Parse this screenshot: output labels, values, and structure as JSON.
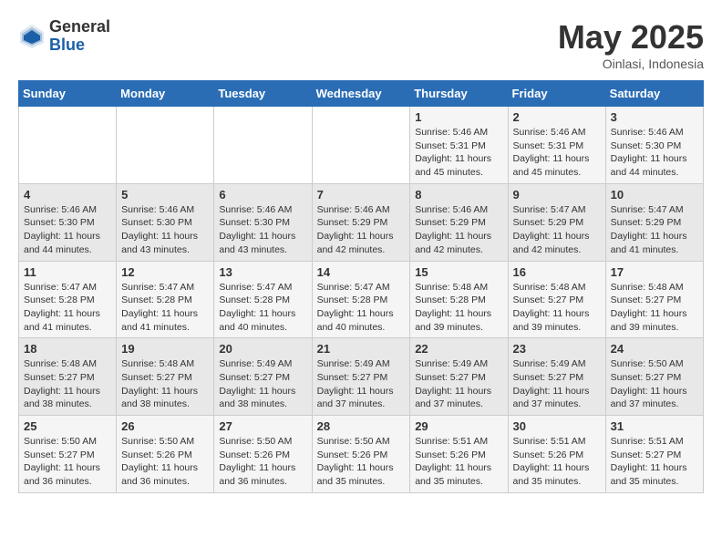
{
  "logo": {
    "general": "General",
    "blue": "Blue"
  },
  "title": "May 2025",
  "subtitle": "Oinlasi, Indonesia",
  "days_header": [
    "Sunday",
    "Monday",
    "Tuesday",
    "Wednesday",
    "Thursday",
    "Friday",
    "Saturday"
  ],
  "weeks": [
    [
      {
        "day": "",
        "info": ""
      },
      {
        "day": "",
        "info": ""
      },
      {
        "day": "",
        "info": ""
      },
      {
        "day": "",
        "info": ""
      },
      {
        "day": "1",
        "info": "Sunrise: 5:46 AM\nSunset: 5:31 PM\nDaylight: 11 hours and 45 minutes."
      },
      {
        "day": "2",
        "info": "Sunrise: 5:46 AM\nSunset: 5:31 PM\nDaylight: 11 hours and 45 minutes."
      },
      {
        "day": "3",
        "info": "Sunrise: 5:46 AM\nSunset: 5:30 PM\nDaylight: 11 hours and 44 minutes."
      }
    ],
    [
      {
        "day": "4",
        "info": "Sunrise: 5:46 AM\nSunset: 5:30 PM\nDaylight: 11 hours and 44 minutes."
      },
      {
        "day": "5",
        "info": "Sunrise: 5:46 AM\nSunset: 5:30 PM\nDaylight: 11 hours and 43 minutes."
      },
      {
        "day": "6",
        "info": "Sunrise: 5:46 AM\nSunset: 5:30 PM\nDaylight: 11 hours and 43 minutes."
      },
      {
        "day": "7",
        "info": "Sunrise: 5:46 AM\nSunset: 5:29 PM\nDaylight: 11 hours and 42 minutes."
      },
      {
        "day": "8",
        "info": "Sunrise: 5:46 AM\nSunset: 5:29 PM\nDaylight: 11 hours and 42 minutes."
      },
      {
        "day": "9",
        "info": "Sunrise: 5:47 AM\nSunset: 5:29 PM\nDaylight: 11 hours and 42 minutes."
      },
      {
        "day": "10",
        "info": "Sunrise: 5:47 AM\nSunset: 5:29 PM\nDaylight: 11 hours and 41 minutes."
      }
    ],
    [
      {
        "day": "11",
        "info": "Sunrise: 5:47 AM\nSunset: 5:28 PM\nDaylight: 11 hours and 41 minutes."
      },
      {
        "day": "12",
        "info": "Sunrise: 5:47 AM\nSunset: 5:28 PM\nDaylight: 11 hours and 41 minutes."
      },
      {
        "day": "13",
        "info": "Sunrise: 5:47 AM\nSunset: 5:28 PM\nDaylight: 11 hours and 40 minutes."
      },
      {
        "day": "14",
        "info": "Sunrise: 5:47 AM\nSunset: 5:28 PM\nDaylight: 11 hours and 40 minutes."
      },
      {
        "day": "15",
        "info": "Sunrise: 5:48 AM\nSunset: 5:28 PM\nDaylight: 11 hours and 39 minutes."
      },
      {
        "day": "16",
        "info": "Sunrise: 5:48 AM\nSunset: 5:27 PM\nDaylight: 11 hours and 39 minutes."
      },
      {
        "day": "17",
        "info": "Sunrise: 5:48 AM\nSunset: 5:27 PM\nDaylight: 11 hours and 39 minutes."
      }
    ],
    [
      {
        "day": "18",
        "info": "Sunrise: 5:48 AM\nSunset: 5:27 PM\nDaylight: 11 hours and 38 minutes."
      },
      {
        "day": "19",
        "info": "Sunrise: 5:48 AM\nSunset: 5:27 PM\nDaylight: 11 hours and 38 minutes."
      },
      {
        "day": "20",
        "info": "Sunrise: 5:49 AM\nSunset: 5:27 PM\nDaylight: 11 hours and 38 minutes."
      },
      {
        "day": "21",
        "info": "Sunrise: 5:49 AM\nSunset: 5:27 PM\nDaylight: 11 hours and 37 minutes."
      },
      {
        "day": "22",
        "info": "Sunrise: 5:49 AM\nSunset: 5:27 PM\nDaylight: 11 hours and 37 minutes."
      },
      {
        "day": "23",
        "info": "Sunrise: 5:49 AM\nSunset: 5:27 PM\nDaylight: 11 hours and 37 minutes."
      },
      {
        "day": "24",
        "info": "Sunrise: 5:50 AM\nSunset: 5:27 PM\nDaylight: 11 hours and 37 minutes."
      }
    ],
    [
      {
        "day": "25",
        "info": "Sunrise: 5:50 AM\nSunset: 5:27 PM\nDaylight: 11 hours and 36 minutes."
      },
      {
        "day": "26",
        "info": "Sunrise: 5:50 AM\nSunset: 5:26 PM\nDaylight: 11 hours and 36 minutes."
      },
      {
        "day": "27",
        "info": "Sunrise: 5:50 AM\nSunset: 5:26 PM\nDaylight: 11 hours and 36 minutes."
      },
      {
        "day": "28",
        "info": "Sunrise: 5:50 AM\nSunset: 5:26 PM\nDaylight: 11 hours and 35 minutes."
      },
      {
        "day": "29",
        "info": "Sunrise: 5:51 AM\nSunset: 5:26 PM\nDaylight: 11 hours and 35 minutes."
      },
      {
        "day": "30",
        "info": "Sunrise: 5:51 AM\nSunset: 5:26 PM\nDaylight: 11 hours and 35 minutes."
      },
      {
        "day": "31",
        "info": "Sunrise: 5:51 AM\nSunset: 5:27 PM\nDaylight: 11 hours and 35 minutes."
      }
    ]
  ]
}
